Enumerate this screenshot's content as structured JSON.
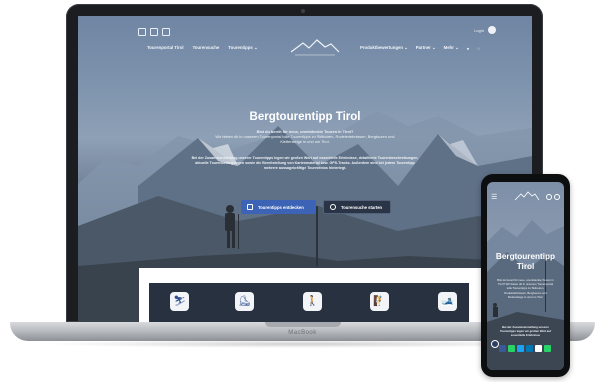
{
  "laptop": {
    "brand": "MacBook",
    "header": {
      "login_label": "Login",
      "nav_left": [
        "Tourenportal Tirol",
        "Tourensuche",
        "Tourentipps ⌄"
      ],
      "nav_right": [
        "Produktbewertungen ⌄",
        "Partner ⌄",
        "Mehr ⌄"
      ],
      "logo_text": "Bergtourentipp Tirol"
    },
    "hero": {
      "title": "Bergtourentipp Tirol",
      "intro_strong": "Bist du bereit für neue, unentdeckte Touren in Tirol?",
      "intro": "Wir bieten dir in unserem Tourenportal tolle Tourentipps zu Skitouren, Rodelerlebnissen, Bergtouren und Klettersteige in und um Tirol.",
      "body": "Bei der Zusammenstellung unserer Tourentipps legen wir großen Wert auf essentielle Erlebnisse, detaillierte Tourenbeschreibungen, aktuelle Tourenbedingungen sowie die Bereitstellung von Kartenmaterial bzw. GPS-Tracks. Außerdem sind bei jedem Tourentipp mehrere aussagekräftige Tourenfotos hinterlegt.",
      "primary_button": "Tourentipps entdecken",
      "secondary_button": "Tourensuche starten"
    },
    "categories": [
      "skitour-icon",
      "rodel-icon",
      "wander-icon",
      "kletter-icon",
      "ski-icon"
    ]
  },
  "phone": {
    "title": "Bergtourentipp Tirol",
    "intro": "Bist du bereit für neue, unentdeckte Touren in Tirol? Wir bieten dir in unserem Tourenportal tolle Tourentipps zu Skitouren, Rodelerlebnissen, Bergtouren und Klettersteige in und um Tirol.",
    "body": "Bei der Zusammenstellung unserer Tourentipps legen wir großen Wert auf essentielle Erlebnisse",
    "dock_colors": [
      "#3b5998",
      "#25d366",
      "#1da1f2",
      "#0077b5",
      "#ffffff",
      "#25d366"
    ]
  }
}
